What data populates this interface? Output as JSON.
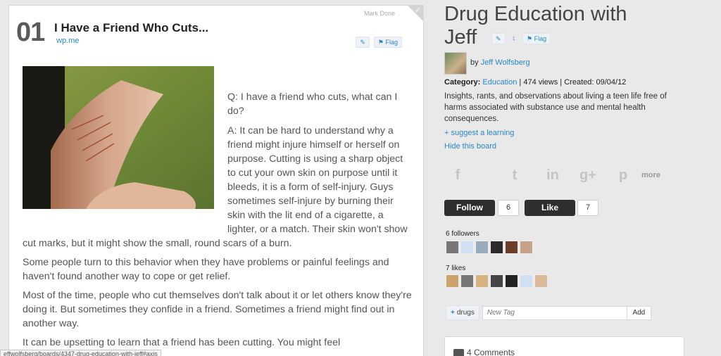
{
  "item": {
    "number": "01",
    "title": "I Have a Friend Who Cuts...",
    "source": "wp.me",
    "mark_done": "Mark Done",
    "flag_label": "Flag",
    "paragraphs": [
      "Q: I have a friend who cuts, what can I do?",
      "A: It can be hard to understand why a friend might injure himself or herself on purpose. Cutting is using a sharp object to cut your own skin on purpose until it bleeds, it is a form of self-injury. Guys sometimes self-injure by burning their skin with the lit end of a cigarette, a lighter, or a match. Their skin won't show cut marks, but it might show the small, round scars of a burn.",
      "Some people turn to this behavior when they have problems or painful feelings and haven't found another way to cope or get relief.",
      "Most of the time, people who cut themselves don't talk about it or let others know they're doing it. But sometimes they confide in a friend. Sometimes a friend might find out in another way.",
      "It can be upsetting to learn that a friend has been cutting. You might feel"
    ]
  },
  "board": {
    "title": "Drug Education with Jeff",
    "flag_label": "Flag",
    "by_label": "by",
    "author": "Jeff Wolfsberg",
    "category_label": "Category:",
    "category": "Education",
    "views": "474 views",
    "created": "Created: 09/04/12",
    "description": "Insights, rants, and observations about living a teen life free of harms associated with substance use and mental health consequences.",
    "suggest_label": "+ suggest a learning",
    "hide_label": "Hide this board"
  },
  "social": {
    "facebook": "f",
    "twitter": "t",
    "linkedin": "in",
    "googleplus": "g+",
    "pinterest": "p",
    "more": "more"
  },
  "actions": {
    "follow_label": "Follow",
    "follow_count": "6",
    "like_label": "Like",
    "like_count": "7"
  },
  "followers_label": "6 followers",
  "likes_label": "7 likes",
  "tags": {
    "tag": "drugs",
    "input_placeholder": "New Tag",
    "add_label": "Add"
  },
  "comments_label": "4 Comments",
  "status_url": "effwolfsberg/boards/4347-drug-education-with-jeff#axis",
  "colors": {
    "link": "#2a87c6",
    "button_dark": "#2e2e2e",
    "background": "#e9e9e9"
  }
}
